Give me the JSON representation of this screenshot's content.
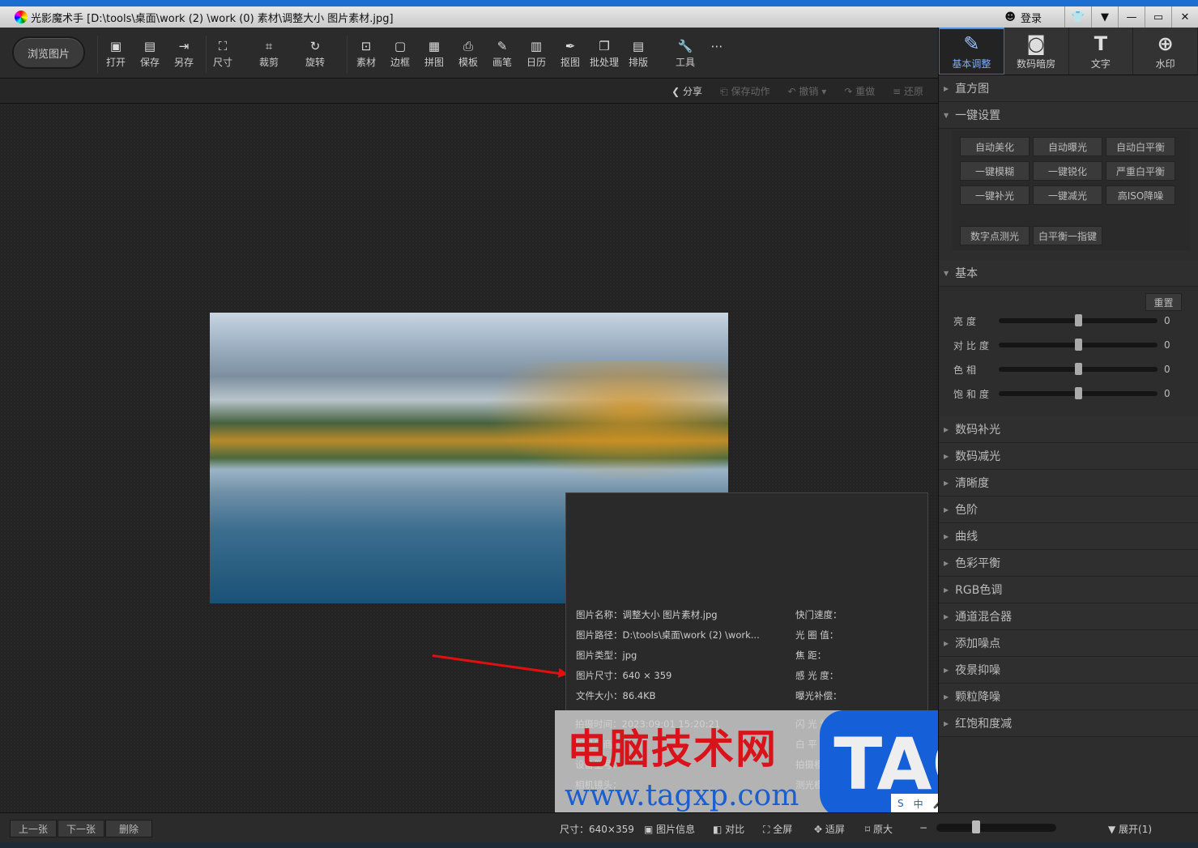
{
  "window": {
    "title": "光影魔术手  [D:\\tools\\桌面\\work (2) \\work (0) 素材\\调整大小 图片素材.jpg]",
    "login": "登录"
  },
  "toolbar": {
    "browse": "浏览图片",
    "tools": [
      "打开",
      "保存",
      "另存",
      "尺寸",
      "裁剪",
      "旋转",
      "素材",
      "边框",
      "拼图",
      "模板",
      "画笔",
      "日历",
      "抠图",
      "批处理",
      "排版",
      "工具"
    ]
  },
  "subbar": {
    "share": "分享",
    "save_action": "保存动作",
    "undo": "撤销",
    "redo": "重做",
    "restore": "还原"
  },
  "right_tabs": [
    "基本调整",
    "数码暗房",
    "文字",
    "水印"
  ],
  "panel": {
    "histogram": "直方图",
    "one_click": "一键设置",
    "buttons": [
      "自动美化",
      "自动曝光",
      "自动白平衡",
      "一键模糊",
      "一键锐化",
      "严重白平衡",
      "一键补光",
      "一键减光",
      "高ISO降噪",
      "数字点测光",
      "白平衡一指键"
    ],
    "basic": "基本",
    "reset": "重置",
    "sliders": [
      {
        "label": "亮度",
        "value": 0
      },
      {
        "label": "对比度",
        "value": 0
      },
      {
        "label": "色相",
        "value": 0
      },
      {
        "label": "饱和度",
        "value": 0
      }
    ],
    "sections": [
      "数码补光",
      "数码减光",
      "清晰度",
      "色阶",
      "曲线",
      "色彩平衡",
      "RGB色调",
      "通道混合器",
      "添加噪点",
      "夜景抑噪",
      "颗粒降噪",
      "红饱和度减"
    ]
  },
  "info": {
    "left": [
      "图片名称：调整大小 图片素材.jpg",
      "图片路径：D:\\tools\\桌面\\work (2) \\work...",
      "图片类型：jpg",
      "图片尺寸：640 × 359",
      "文件大小：86.4KB",
      "拍摄时间：2023:09:01 15:20:21",
      "相机厂商：",
      "设备型号：",
      "相机镜头："
    ],
    "right": [
      "快门速度：",
      "光 圈 值：",
      "焦    距：",
      "感 光 度：",
      "曝光补偿：",
      "闪 光 灯：",
      "白 平 衡：",
      "拍摄模式：",
      "测光模式："
    ]
  },
  "watermark": {
    "cn": "电脑技术网",
    "url": "www.tagxp.com",
    "tag": "TAG",
    "ime": "中"
  },
  "bottom": {
    "prev": "上一张",
    "next": "下一张",
    "delete": "删除",
    "size": "尺寸：640×359",
    "info": "图片信息",
    "compare": "对比",
    "fullscreen": "全屏",
    "fit": "适屏",
    "original": "原大",
    "expand": "展开(1)",
    "zoom_fraction": 0.32
  }
}
